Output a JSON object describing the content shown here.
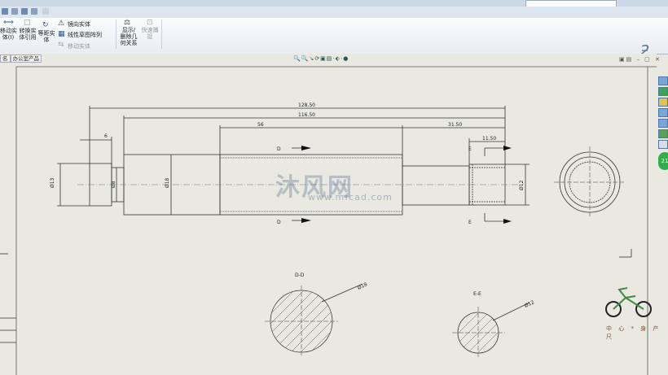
{
  "app": {
    "search_placeholder": ""
  },
  "ribbon": {
    "b1": "移动实\n体(I)",
    "b2": "转换实\n体引用",
    "b3": "等距实\n体",
    "mirror": "镜向实体",
    "linear_pattern": "线性草图阵列",
    "move": "移动实体",
    "show_delete": "显示/\n删除几\n何关系",
    "quick_snap": "快速捕\n捉"
  },
  "tabs": [
    "名",
    "办公室产品"
  ],
  "drawing": {
    "dims": {
      "d_128": "128.50",
      "d_116": "116.50",
      "d_56": "56",
      "d_31": "31.50",
      "d_11": "11.50",
      "d_6": "6",
      "phi13": "Ø13",
      "phi8": "Ø8",
      "phi18": "Ø18",
      "phi12": "Ø12"
    },
    "section_labels": {
      "d_top": "D",
      "d_bottom": "D",
      "e_top": "E",
      "e_bottom": "E",
      "dd": "D-D",
      "ee": "E-E",
      "phi18_sec": "Ø18",
      "phi12_sec": "Ø12"
    }
  },
  "watermark": {
    "cn": "沐风网",
    "url": "www.mfcad.com"
  },
  "side_badge": "21",
  "bike_caption": "中 心 * 身 产 尺"
}
